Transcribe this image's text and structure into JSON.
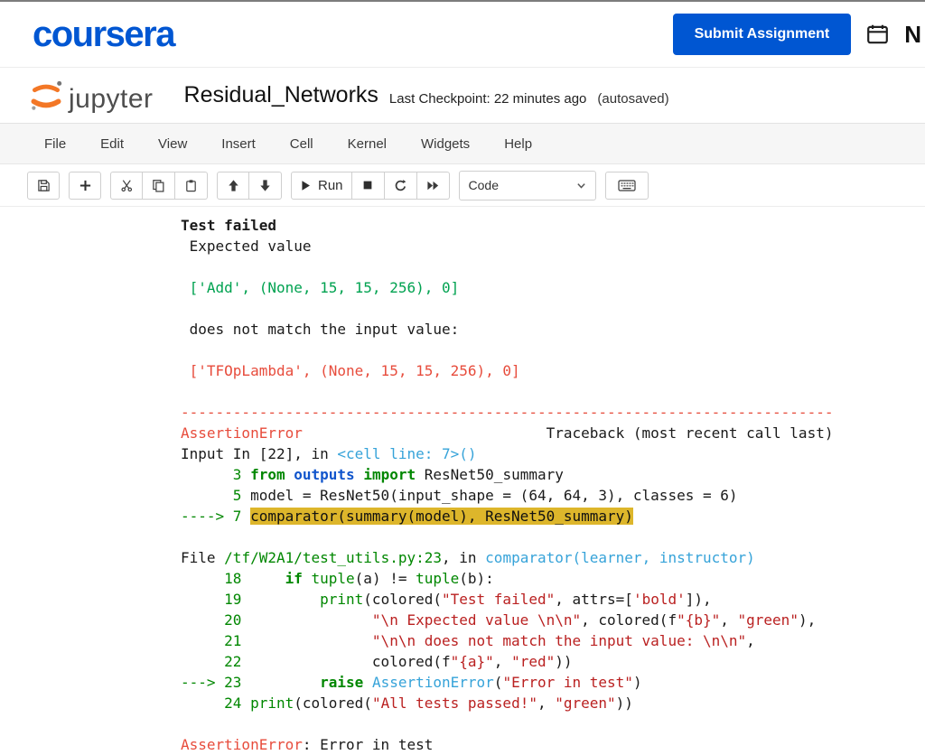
{
  "colors": {
    "brand_blue": "#0056d2",
    "jupyter_orange": "#f37726",
    "highlight_yellow": "#ddb62b",
    "ansi_red": "#e74c3c",
    "code_green": "#008700",
    "output_green": "#00a250",
    "string_red": "#ba2121",
    "cyan": "#36a3d9"
  },
  "topbar": {
    "brand": "coursera",
    "submit_label": "Submit Assignment",
    "partner_initial": "N"
  },
  "jupyter_header": {
    "logo_text": "jupyter",
    "title": "Residual_Networks",
    "checkpoint": "Last Checkpoint: 22 minutes ago",
    "autosave_status": "(autosaved)"
  },
  "menu": {
    "items": [
      "File",
      "Edit",
      "View",
      "Insert",
      "Cell",
      "Kernel",
      "Widgets",
      "Help"
    ]
  },
  "toolbar": {
    "run_label": "Run",
    "cell_type_selected": "Code",
    "icon_names": [
      "save-icon",
      "add-cell-icon",
      "cut-icon",
      "copy-icon",
      "paste-icon",
      "move-up-icon",
      "move-down-icon",
      "run-icon",
      "stop-icon",
      "restart-icon",
      "restart-run-all-icon",
      "keyboard-icon",
      "chevron-down-icon"
    ]
  },
  "traceback": {
    "lines": [
      [
        {
          "t": "Test failed",
          "c": "b"
        }
      ],
      [
        {
          "t": " Expected value "
        }
      ],
      [],
      [
        {
          "t": " ['Add', (None, 15, 15, 256), 0] ",
          "c": "g2"
        }
      ],
      [],
      [
        {
          "t": " does not match the input value: "
        }
      ],
      [],
      [
        {
          "t": " ['TFOpLambda', (None, 15, 15, 256), 0] ",
          "c": "r"
        }
      ],
      [],
      [
        {
          "t": "---------------------------------------------------------------------------",
          "c": "r"
        }
      ],
      [
        {
          "t": "AssertionError",
          "c": "r"
        },
        {
          "t": "                            Traceback (most recent call last)"
        }
      ],
      [
        {
          "t": "Input In [22], in "
        },
        {
          "t": "<cell line: 7>()",
          "c": "c"
        }
      ],
      [
        {
          "t": "      3 ",
          "c": "g"
        },
        {
          "t": "from",
          "c": "gb"
        },
        {
          "t": " "
        },
        {
          "t": "outputs",
          "c": "nbm"
        },
        {
          "t": " "
        },
        {
          "t": "import",
          "c": "gb"
        },
        {
          "t": " ResNet50_summary"
        }
      ],
      [
        {
          "t": "      5 ",
          "c": "g"
        },
        {
          "t": "model = ResNet50(input_shape = (64, 64, 3), classes = 6)"
        }
      ],
      [
        {
          "t": "----> 7 ",
          "c": "g"
        },
        {
          "t": "comparator(summary(model), ResNet50_summary)",
          "c": "hl"
        }
      ],
      [],
      [
        {
          "t": "File "
        },
        {
          "t": "/tf/W2A1/test_utils.py:23",
          "c": "g"
        },
        {
          "t": ", in "
        },
        {
          "t": "comparator(learner, instructor)",
          "c": "c"
        }
      ],
      [
        {
          "t": "     18 ",
          "c": "g"
        },
        {
          "t": "    "
        },
        {
          "t": "if",
          "c": "gb"
        },
        {
          "t": " "
        },
        {
          "t": "tuple",
          "c": "g"
        },
        {
          "t": "(a) != "
        },
        {
          "t": "tuple",
          "c": "g"
        },
        {
          "t": "(b):"
        }
      ],
      [
        {
          "t": "     19 ",
          "c": "g"
        },
        {
          "t": "        "
        },
        {
          "t": "print",
          "c": "g"
        },
        {
          "t": "(colored("
        },
        {
          "t": "\"Test failed\"",
          "c": "s"
        },
        {
          "t": ", attrs=["
        },
        {
          "t": "'bold'",
          "c": "s"
        },
        {
          "t": "]),"
        }
      ],
      [
        {
          "t": "     20 ",
          "c": "g"
        },
        {
          "t": "              "
        },
        {
          "t": "\"\\n Expected value \\n\\n\"",
          "c": "s"
        },
        {
          "t": ", colored(f"
        },
        {
          "t": "\"{b}\"",
          "c": "s"
        },
        {
          "t": ", "
        },
        {
          "t": "\"green\"",
          "c": "s"
        },
        {
          "t": "),"
        }
      ],
      [
        {
          "t": "     21 ",
          "c": "g"
        },
        {
          "t": "              "
        },
        {
          "t": "\"\\n\\n does not match the input value: \\n\\n\"",
          "c": "s"
        },
        {
          "t": ","
        }
      ],
      [
        {
          "t": "     22 ",
          "c": "g"
        },
        {
          "t": "              "
        },
        {
          "t": "colored(f"
        },
        {
          "t": "\"{a}\"",
          "c": "s"
        },
        {
          "t": ", "
        },
        {
          "t": "\"red\"",
          "c": "s"
        },
        {
          "t": "))"
        }
      ],
      [
        {
          "t": "---> 23 ",
          "c": "g"
        },
        {
          "t": "        "
        },
        {
          "t": "raise",
          "c": "gb"
        },
        {
          "t": " "
        },
        {
          "t": "AssertionError",
          "c": "c"
        },
        {
          "t": "("
        },
        {
          "t": "\"Error in test\"",
          "c": "s"
        },
        {
          "t": ")"
        }
      ],
      [
        {
          "t": "     24 ",
          "c": "g"
        },
        {
          "t": "print",
          "c": "g"
        },
        {
          "t": "(colored("
        },
        {
          "t": "\"All tests passed!\"",
          "c": "s"
        },
        {
          "t": ", "
        },
        {
          "t": "\"green\"",
          "c": "s"
        },
        {
          "t": "))"
        }
      ],
      [],
      [
        {
          "t": "AssertionError",
          "c": "r"
        },
        {
          "t": ": Error in test"
        }
      ]
    ]
  }
}
